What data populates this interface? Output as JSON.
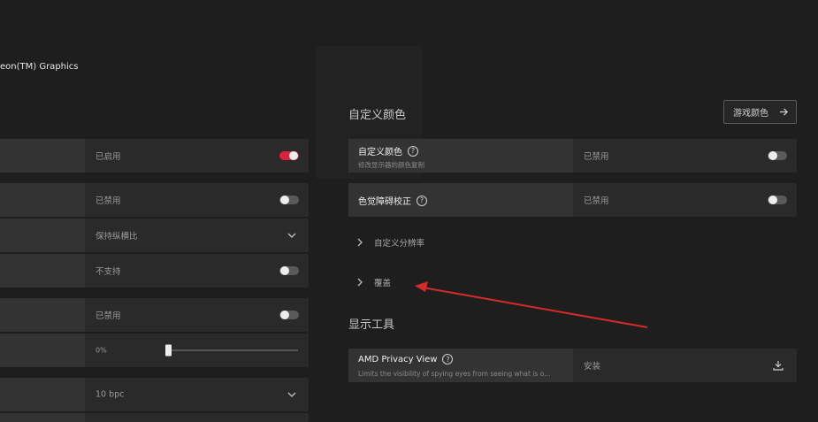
{
  "device": {
    "gpu_name": "eon(TM) Graphics"
  },
  "left_panel": {
    "rows": [
      {
        "value": "已启用",
        "control": "toggle",
        "state": "on"
      },
      {
        "value": "已禁用",
        "control": "toggle",
        "state": "off"
      },
      {
        "value": "保持纵横比",
        "control": "dropdown"
      },
      {
        "value": "不支持",
        "control": "toggle",
        "state": "off"
      },
      {
        "value": "已禁用",
        "control": "toggle",
        "state": "off"
      },
      {
        "value": "0%",
        "control": "slider",
        "level_percent": 0
      },
      {
        "value": "10 bpc",
        "control": "dropdown"
      }
    ]
  },
  "custom_color": {
    "title": "自定义颜色",
    "game_color_button": "游戏颜色",
    "rows": [
      {
        "label": "自定义颜色",
        "sub": "修改显示器的颜色复制",
        "value": "已禁用",
        "state": "off"
      },
      {
        "label": "色觉障碍校正",
        "value": "已禁用",
        "state": "off"
      }
    ],
    "expanders": [
      "自定义分辨率",
      "覆盖"
    ]
  },
  "display_tools": {
    "title": "显示工具",
    "rows": [
      {
        "label": "AMD Privacy View",
        "sub": "Limits the visibility of spying eyes from seeing what is o...",
        "value": "安装"
      }
    ]
  },
  "colors": {
    "accent": "#d9223b",
    "annotation_arrow": "#d42a2a"
  }
}
